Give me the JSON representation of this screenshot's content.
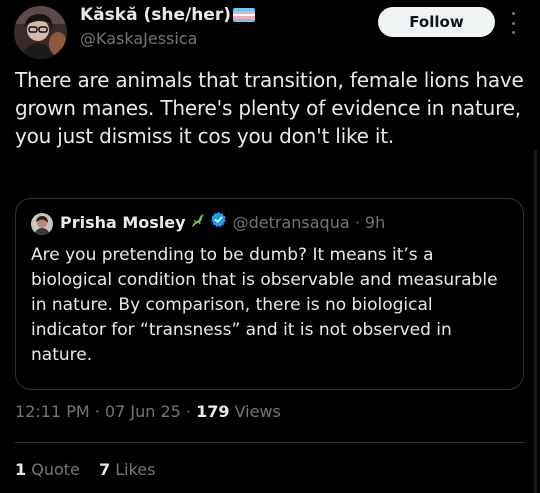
{
  "author": {
    "display_name": "Kăskă (she/her)",
    "flag_colors": [
      "#5bcefa",
      "#f5a9b8",
      "#ffffff",
      "#f5a9b8",
      "#5bcefa"
    ],
    "handle": "@KaskaJessica"
  },
  "follow_label": "Follow",
  "tweet_text": "There are animals that transition, female lions have grown manes. There's plenty of evidence in nature, you just dismiss it cos you don't like it.",
  "quote": {
    "name": "Prisha Mosley",
    "handle": "@detransaqua",
    "separator": "·",
    "time": "9h",
    "text": "Are you pretending to be dumb? It means it’s a biological condition that is observable and measurable in nature. By comparison, there is no biological indicator for “transness” and it is not observed in nature."
  },
  "meta": {
    "time": "12:11 PM",
    "date": "07 Jun 25",
    "views_count": "179",
    "views_label": "Views"
  },
  "stats": {
    "quotes_count": "1",
    "quotes_label": "Quote",
    "likes_count": "7",
    "likes_label": "Likes"
  },
  "colors": {
    "background": "#000000",
    "text": "#e7e9ea",
    "secondary": "#71767b",
    "border": "#2f3336",
    "verified": "#1d9bf0",
    "follow_bg": "#eff3f4"
  }
}
